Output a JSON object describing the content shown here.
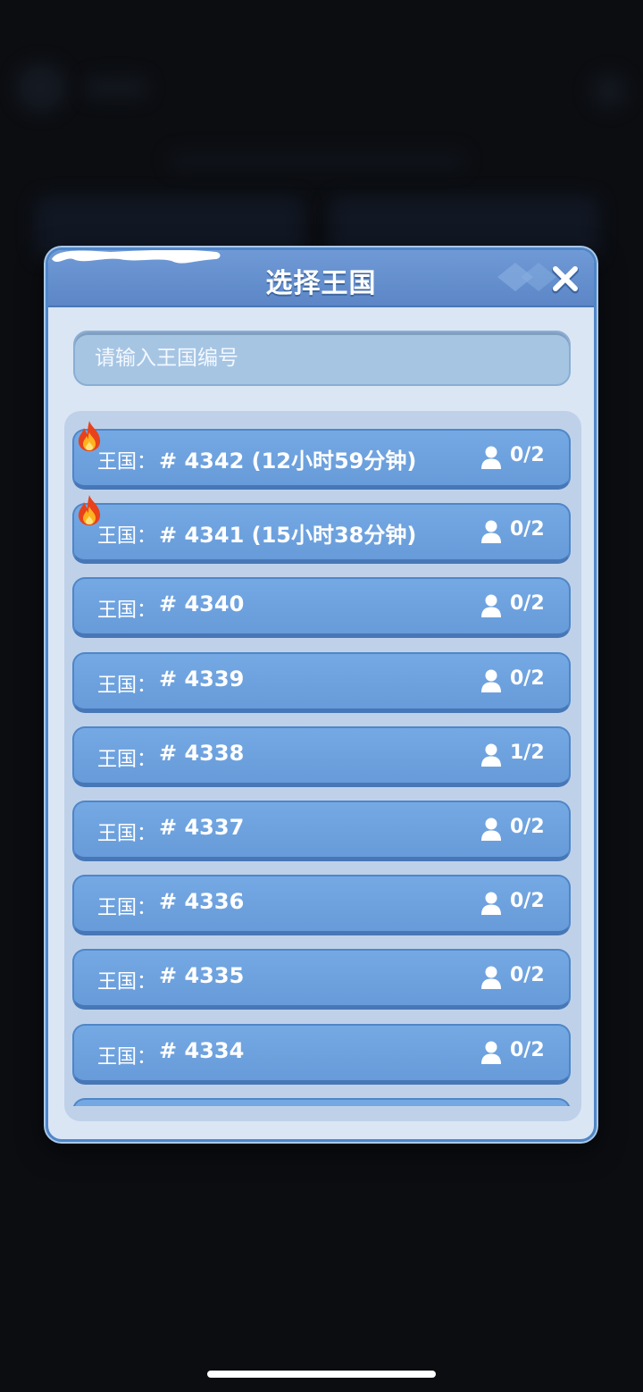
{
  "dialog": {
    "title": "选择王国",
    "search_placeholder": "请输入王国编号"
  },
  "kingdoms": [
    {
      "label": "王国：",
      "number": "# 4342 (12小时59分钟)",
      "count": "0/2",
      "hot": true
    },
    {
      "label": "王国：",
      "number": "# 4341 (15小时38分钟)",
      "count": "0/2",
      "hot": true
    },
    {
      "label": "王国：",
      "number": "# 4340",
      "count": "0/2",
      "hot": false
    },
    {
      "label": "王国：",
      "number": "# 4339",
      "count": "0/2",
      "hot": false
    },
    {
      "label": "王国：",
      "number": "# 4338",
      "count": "1/2",
      "hot": false
    },
    {
      "label": "王国：",
      "number": "# 4337",
      "count": "0/2",
      "hot": false
    },
    {
      "label": "王国：",
      "number": "# 4336",
      "count": "0/2",
      "hot": false
    },
    {
      "label": "王国：",
      "number": "# 4335",
      "count": "0/2",
      "hot": false
    },
    {
      "label": "王国：",
      "number": "# 4334",
      "count": "0/2",
      "hot": false
    }
  ],
  "colors": {
    "backdrop": "#0b0d11",
    "dialog_bg": "#dbe6f4",
    "header": "#6f9ad6",
    "row": "#75a9e4",
    "fire": "#e8421c"
  },
  "icons": {
    "close": "close-icon",
    "member": "person-icon",
    "hot": "fire-icon"
  }
}
